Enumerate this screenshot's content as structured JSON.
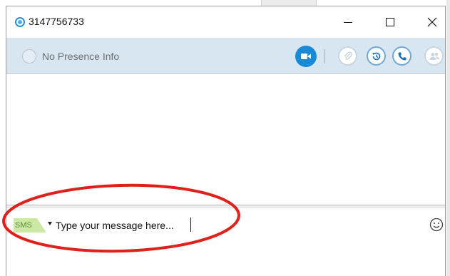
{
  "window": {
    "title": "3147756733"
  },
  "presence": {
    "status_text": "No Presence Info"
  },
  "toolbar": {
    "icons": [
      "video-icon",
      "attach-icon",
      "history-icon",
      "phone-icon",
      "contacts-icon"
    ]
  },
  "compose": {
    "channel_label": "SMS",
    "placeholder": "Type your message here..."
  },
  "colors": {
    "accent": "#1a8ad6",
    "presence_bar": "#d8e6f1",
    "sms_badge": "#cbe8a4",
    "annotation": "#e0201b"
  }
}
